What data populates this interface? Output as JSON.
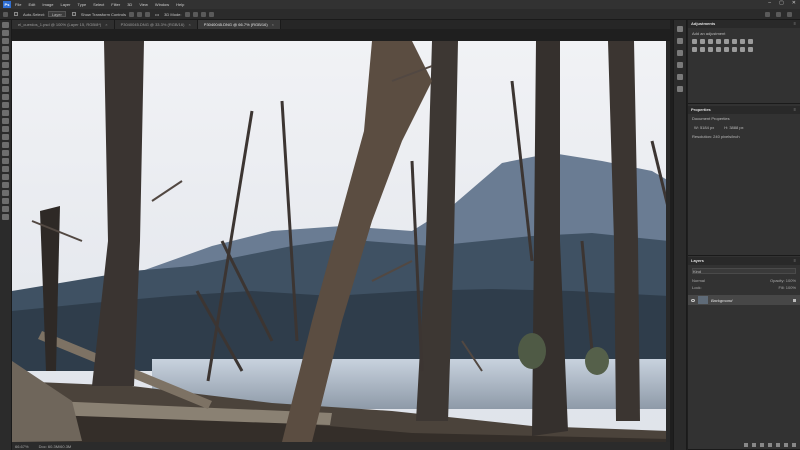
{
  "menubar": {
    "logo": "Ps",
    "items": [
      "File",
      "Edit",
      "Image",
      "Layer",
      "Type",
      "Select",
      "Filter",
      "3D",
      "View",
      "Window",
      "Help"
    ],
    "window_controls": [
      "–",
      "▢",
      "✕"
    ]
  },
  "options": {
    "auto_select": "Auto-Select:",
    "auto_select_target": "Layer",
    "show_transform": "Show Transform Controls",
    "mode_3d": "3D Mode:",
    "more": "•••"
  },
  "tabs": [
    {
      "label": "el_cuerdos_1.psd @ 100% (Layer 15, RGB/8*)",
      "active": false
    },
    {
      "label": "P3040045.DNG @ 33.3% (RGB/16)",
      "active": false
    },
    {
      "label": "P3040045.DNG @ 66.7% (RGB/16)",
      "active": true
    }
  ],
  "status": {
    "zoom": "66.67%",
    "doc": "Doc: 60.3M/60.3M"
  },
  "adjustments": {
    "title": "Adjustments",
    "subtitle": "Add an adjustment"
  },
  "properties": {
    "title": "Properties",
    "section": "Document Properties",
    "width_label": "W:",
    "width_value": "5184 px",
    "height_label": "H:",
    "height_value": "3888 px",
    "resolution": "Resolution: 240 pixels/inch"
  },
  "layers": {
    "title": "Layers",
    "kind_label": "Kind",
    "mode": "Normal",
    "opacity": "Opacity: 100%",
    "lock_label": "Lock:",
    "fill": "Fill: 100%",
    "layer_name": "Background"
  },
  "colors": {
    "accent": "#2f6fd3",
    "panel_bg": "#323232",
    "canvas_bg": "#262626"
  }
}
